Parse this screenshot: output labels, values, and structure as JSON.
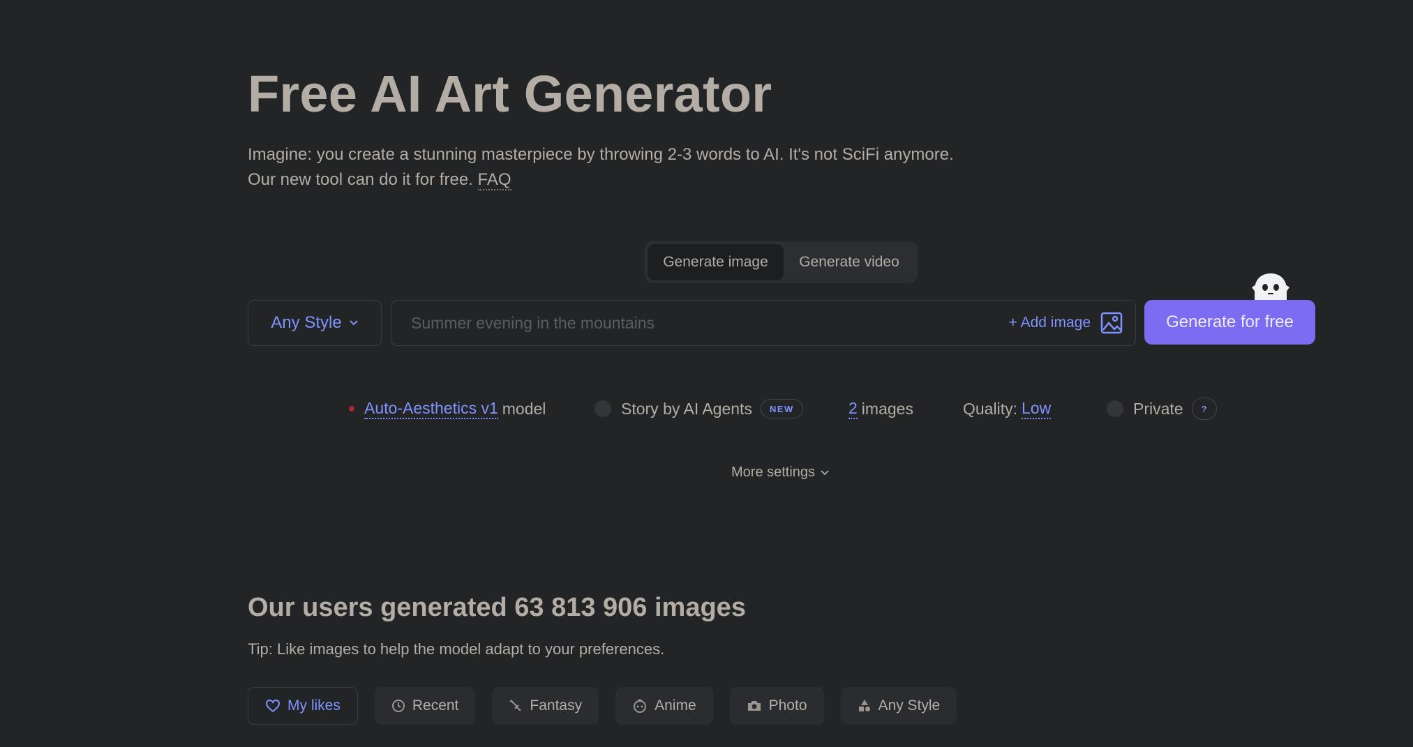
{
  "header": {
    "title": "Free AI Art Generator",
    "intro_line1": "Imagine: you create a stunning masterpiece by throwing 2-3 words to AI. It's not SciFi anymore.",
    "intro_line2": "Our new tool can do it for free.",
    "faq_link": "FAQ"
  },
  "mode_tabs": [
    "Generate image",
    "Generate video"
  ],
  "prompt": {
    "style_label": "Any Style",
    "placeholder": "Summer evening in the mountains",
    "value": "",
    "add_image_label": "+ Add image",
    "generate_label": "Generate for free"
  },
  "options": {
    "model_name": "Auto-Aesthetics v1",
    "model_suffix": "model",
    "story_label": "Story by AI Agents",
    "new_badge": "NEW",
    "images_count": "2",
    "images_suffix": "images",
    "quality_label": "Quality:",
    "quality_value": "Low",
    "private_label": "Private",
    "help_badge": "?",
    "more_settings": "More settings"
  },
  "stats": {
    "title": "Our users generated 63 813 906 images",
    "tip": "Tip: Like images to help the model adapt to your preferences."
  },
  "filters": [
    {
      "label": "My likes",
      "icon": "heart-icon"
    },
    {
      "label": "Recent",
      "icon": "clock-icon"
    },
    {
      "label": "Fantasy",
      "icon": "sword-icon"
    },
    {
      "label": "Anime",
      "icon": "anime-face-icon"
    },
    {
      "label": "Photo",
      "icon": "camera-icon"
    },
    {
      "label": "Any Style",
      "icon": "shapes-icon"
    }
  ],
  "colors": {
    "background": "#232426",
    "text": "#b3ada6",
    "accent": "#7f93ff",
    "primary_button": "#7c6cf2"
  }
}
